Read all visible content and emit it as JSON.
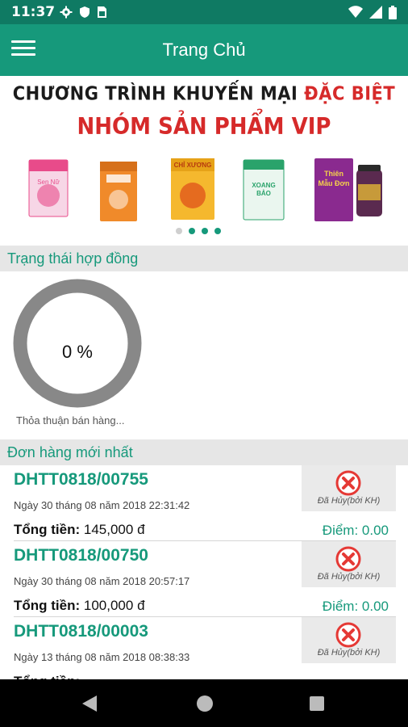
{
  "status_bar": {
    "time": "11:37",
    "left_icons": [
      "gear-icon",
      "shield-icon",
      "sim-card-icon"
    ],
    "right_icons": [
      "wifi-icon",
      "signal-icon",
      "battery-icon"
    ]
  },
  "app_bar": {
    "title": "Trang Chủ",
    "menu_icon": "hamburger-menu-icon"
  },
  "promo": {
    "line1_prefix": "CHƯƠNG TRÌNH KHUYẾN MẠI",
    "line1_highlight": "ĐẶC BIỆT",
    "line2": "NHÓM SẢN PHẨM VIP",
    "products": [
      {
        "name": "Sen Nữ Hương",
        "color": "#e84b8a"
      },
      {
        "name": "Hoàng Kỳ",
        "color": "#f08a2a"
      },
      {
        "name": "Chỉ Xương",
        "color": "#f5b82e"
      },
      {
        "name": "Xoang Bảo",
        "color": "#2aa36b"
      },
      {
        "name": "Thiên Mẫu Đơn",
        "color": "#8a2a8f"
      }
    ],
    "carousel_active_index": 1,
    "carousel_count": 4
  },
  "contract_section": {
    "header": "Trạng thái hợp đồng",
    "percent_label": "0 %",
    "progress": 0,
    "caption": "Thỏa thuận bán hàng..."
  },
  "orders_section": {
    "header": "Đơn hàng mới nhất",
    "orders": [
      {
        "id": "DHTT0818/00755",
        "date": "Ngày 30 tháng 08 năm 2018 22:31:42",
        "total_label": "Tổng tiền:",
        "total_value": "145,000 đ",
        "points": "Điểm: 0.00",
        "status": "Đã Hủy(bởi KH)"
      },
      {
        "id": "DHTT0818/00750",
        "date": "Ngày 30 tháng 08 năm 2018 20:57:17",
        "total_label": "Tổng tiền:",
        "total_value": "100,000 đ",
        "points": "Điểm: 0.00",
        "status": "Đã Hủy(bởi KH)"
      },
      {
        "id": "DHTT0818/00003",
        "date": "Ngày 13 tháng 08 năm 2018 08:38:33",
        "total_label": "Tổng tiền:",
        "total_value": "",
        "points": "",
        "status": "Đã Hủy(bởi KH)"
      }
    ]
  },
  "colors": {
    "primary": "#16997b",
    "status_bar": "#0f7a63",
    "promo_red": "#d62a2a",
    "cancel_red": "#e53935"
  },
  "nav_bar": {
    "buttons": [
      "back-icon",
      "home-icon",
      "recents-icon"
    ]
  }
}
